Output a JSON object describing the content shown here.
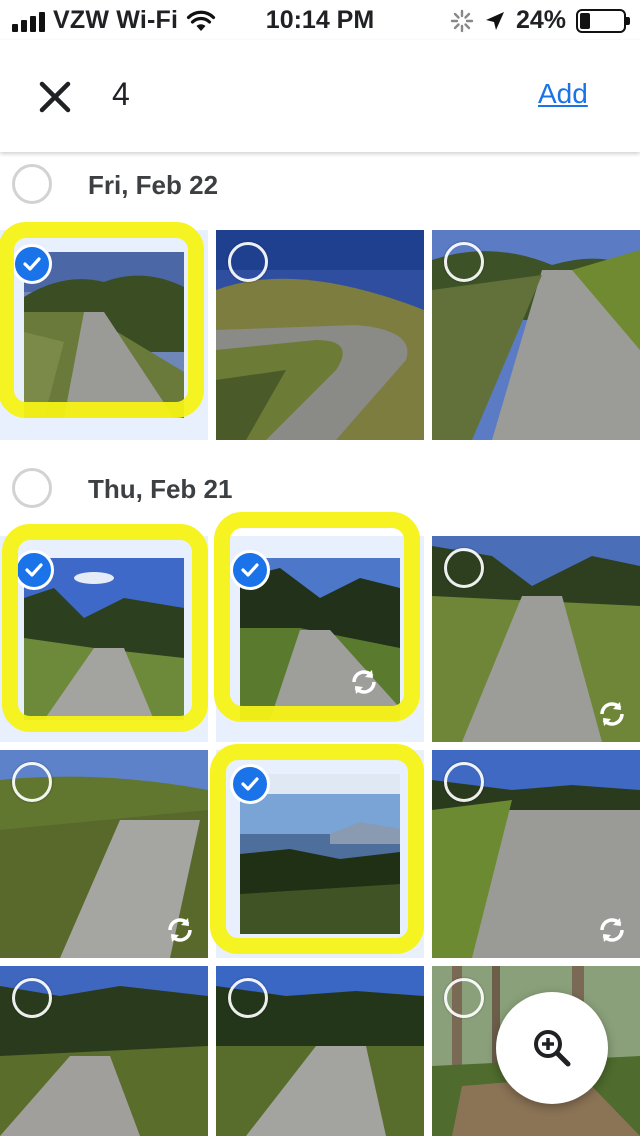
{
  "status_bar": {
    "carrier": "VZW Wi-Fi",
    "time": "10:14 PM",
    "battery_percent": "24%",
    "battery_level": 0.24,
    "icons": [
      "signal-icon",
      "wifi-icon",
      "activity-spinner-icon",
      "location-arrow-icon",
      "battery-icon"
    ]
  },
  "header": {
    "close_icon": "close-icon",
    "selected_count": "4",
    "add_label": "Add"
  },
  "sections": [
    {
      "title": "Fri, Feb 22",
      "photos": [
        {
          "selected": true,
          "live": false,
          "highlighted": true
        },
        {
          "selected": false,
          "live": false,
          "highlighted": false
        },
        {
          "selected": false,
          "live": false,
          "highlighted": false
        }
      ]
    },
    {
      "title": "Thu, Feb 21",
      "photos": [
        {
          "selected": true,
          "live": false,
          "highlighted": true
        },
        {
          "selected": true,
          "live": true,
          "highlighted": true
        },
        {
          "selected": false,
          "live": true,
          "highlighted": false
        },
        {
          "selected": false,
          "live": true,
          "highlighted": false
        },
        {
          "selected": true,
          "live": false,
          "highlighted": true
        },
        {
          "selected": false,
          "live": true,
          "highlighted": false
        },
        {
          "selected": false,
          "live": false,
          "highlighted": false
        },
        {
          "selected": false,
          "live": false,
          "highlighted": false
        },
        {
          "selected": false,
          "live": false,
          "highlighted": false
        }
      ]
    }
  ],
  "fab": {
    "icon": "zoom-in-icon"
  },
  "colors": {
    "accent": "#1a73e8",
    "highlight": "#f5f215",
    "selected_tile_bg": "#e8f0fe"
  }
}
